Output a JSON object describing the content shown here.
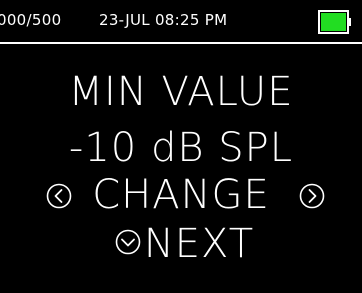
{
  "status": {
    "counter": "000/500",
    "datetime": "23-JUL 08:25 PM",
    "battery_color": "#22dd22"
  },
  "main": {
    "title": "MIN VALUE",
    "value": "-10 dB SPL",
    "change_label": "CHANGE",
    "next_label": "NEXT"
  },
  "icons": {
    "left": "chevron-left-circle-icon",
    "right": "chevron-right-circle-icon",
    "down": "chevron-down-circle-icon"
  }
}
